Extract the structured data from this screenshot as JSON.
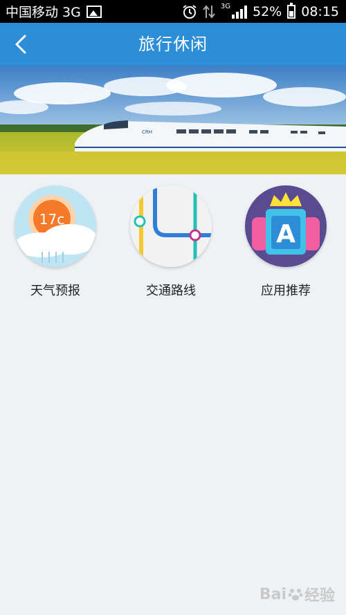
{
  "status_bar": {
    "carrier": "中国移动 3G",
    "net_label": "3G",
    "battery": "52%",
    "time": "08:15"
  },
  "header": {
    "title": "旅行休闲"
  },
  "banner": {
    "train_logo": "CRH"
  },
  "apps": [
    {
      "label": "天气预报",
      "icon": "weather-icon",
      "temperature": "17c"
    },
    {
      "label": "交通路线",
      "icon": "transit-map-icon"
    },
    {
      "label": "应用推荐",
      "icon": "app-store-icon",
      "badge_letter": "A"
    }
  ],
  "watermark": {
    "text": "Bai",
    "suffix": "经验"
  }
}
